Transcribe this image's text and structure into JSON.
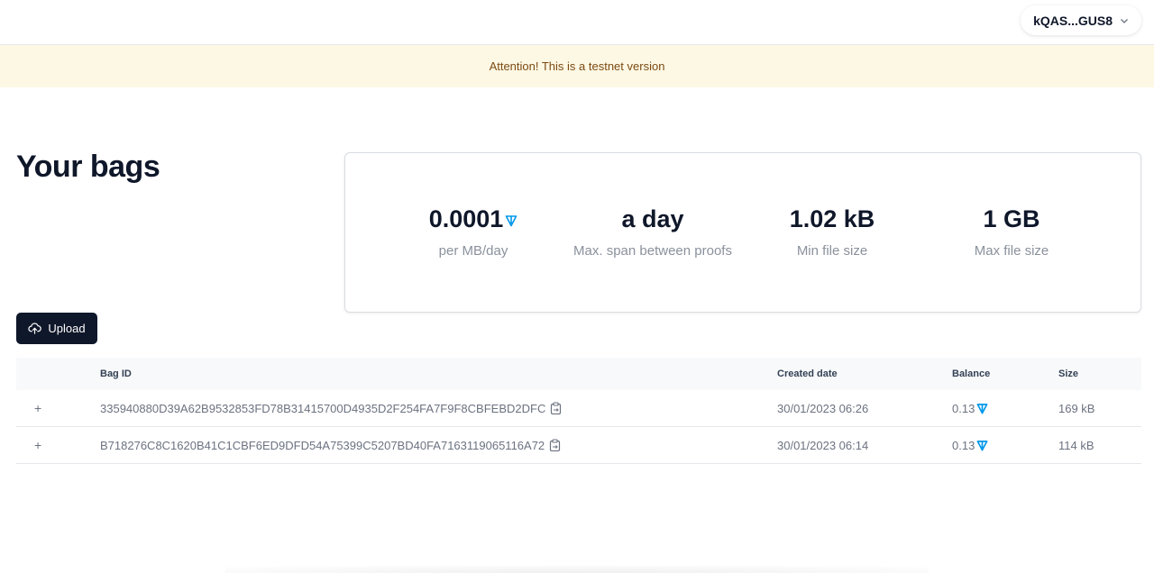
{
  "header": {
    "wallet_address": "kQAS...GUS8"
  },
  "banner": {
    "text": "Attention! This is a testnet version"
  },
  "page": {
    "title": "Your bags"
  },
  "stats": [
    {
      "value": "0.0001",
      "label": "per MB/day",
      "has_ton_icon": true
    },
    {
      "value": "a day",
      "label": "Max. span between proofs"
    },
    {
      "value": "1.02 kB",
      "label": "Min file size"
    },
    {
      "value": "1 GB",
      "label": "Max file size"
    }
  ],
  "actions": {
    "upload_label": "Upload"
  },
  "table": {
    "columns": {
      "bag_id": "Bag ID",
      "created_date": "Created date",
      "balance": "Balance",
      "size": "Size"
    },
    "rows": [
      {
        "expand": "+",
        "bag_id": "335940880D39A62B9532853FD78B31415700D4935D2F254FA7F9F8CBFEBD2DFC",
        "created_date": "30/01/2023 06:26",
        "balance": "0.13",
        "size": "169 kB"
      },
      {
        "expand": "+",
        "bag_id": "B718276C8C1620B41C1CBF6ED9DFD54A75399C5207BD40FA7163119065116A72",
        "created_date": "30/01/2023 06:14",
        "balance": "0.13",
        "size": "114 kB"
      }
    ]
  },
  "colors": {
    "primary": "#0f172a",
    "banner_bg": "#fdf8e4",
    "banner_text": "#7c4a12",
    "ton_icon": "#0098ea"
  }
}
